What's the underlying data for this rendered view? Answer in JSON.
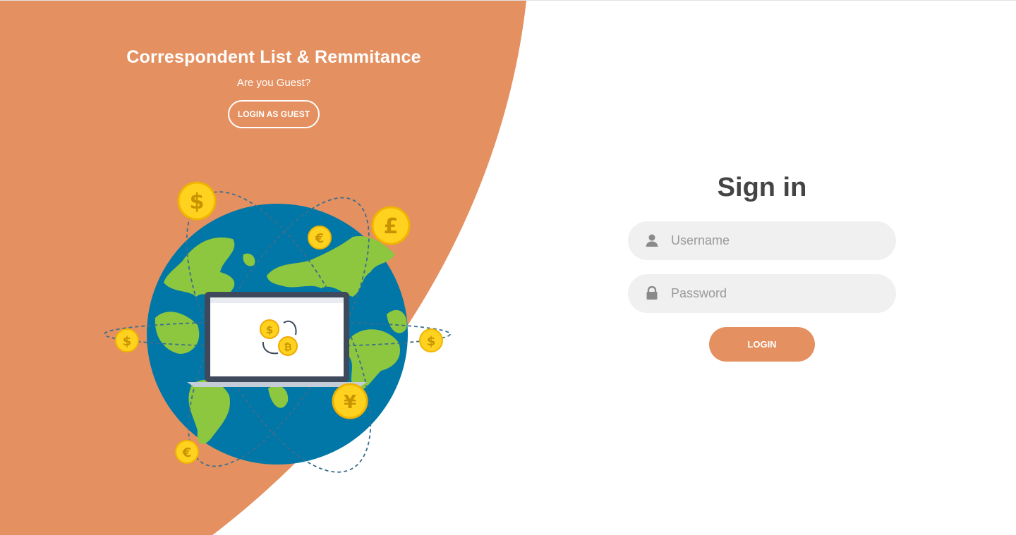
{
  "brand": {
    "title": "Correspondent List & Remmitance",
    "guest_question": "Are you Guest?",
    "guest_button_label": "LOGIN AS GUEST"
  },
  "signin": {
    "title": "Sign in",
    "username_placeholder": "Username",
    "password_placeholder": "Password",
    "login_label": "LOGIN"
  },
  "illustration": {
    "coins": [
      "$",
      "£",
      "€",
      "$",
      "$",
      "¥",
      "€"
    ],
    "laptop_coins": [
      "$",
      "₿"
    ]
  },
  "colors": {
    "accent": "#e49060",
    "ocean": "#0077a6",
    "land": "#8dc63f",
    "coin": "#ffd21f",
    "input_bg": "#f0f0f0",
    "title_text": "#444444"
  },
  "icons": {
    "username": "user-icon",
    "password": "lock-icon"
  }
}
